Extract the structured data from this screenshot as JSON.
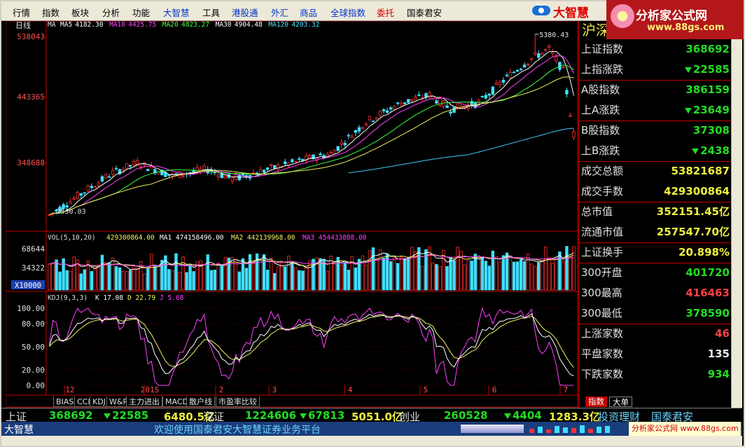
{
  "menu": {
    "items": [
      {
        "label": "行情",
        "style": "normal",
        "pos": 18
      },
      {
        "label": "指数",
        "style": "normal",
        "pos": 60
      },
      {
        "label": "板块",
        "style": "normal",
        "pos": 102
      },
      {
        "label": "分析",
        "style": "normal",
        "pos": 146
      },
      {
        "label": "功能",
        "style": "normal",
        "pos": 189
      },
      {
        "label": "大智慧",
        "style": "blue",
        "pos": 233
      },
      {
        "label": "工具",
        "style": "normal",
        "pos": 289
      },
      {
        "label": "港股通",
        "style": "blue",
        "pos": 331
      },
      {
        "label": "外汇",
        "style": "blue",
        "pos": 387
      },
      {
        "label": "商品",
        "style": "blue",
        "pos": 428
      },
      {
        "label": "全球指数",
        "style": "blue",
        "pos": 472
      },
      {
        "label": "委托",
        "style": "red",
        "pos": 538
      },
      {
        "label": "国泰君安",
        "style": "normal",
        "pos": 581
      }
    ],
    "brand": "大智慧"
  },
  "watermark": {
    "title": "分析家公式网",
    "url": "www.88gs.com"
  },
  "chart": {
    "period_label": "日线",
    "ma_line": {
      "prefix": "MA",
      "items": [
        {
          "name": "MA5",
          "value": "4182.30",
          "color": "#ffffff"
        },
        {
          "name": "MA10",
          "value": "4425.75",
          "color": "#ff40ff"
        },
        {
          "name": "MA20",
          "value": "4823.27",
          "color": "#40ff40"
        },
        {
          "name": "MA30",
          "value": "4904.48",
          "color": "#ffffff"
        },
        {
          "name": "MA120",
          "value": "4203.32",
          "color": "#40e0ff"
        }
      ]
    },
    "price_axis": [
      "538043",
      "443365",
      "348688"
    ],
    "high_label": "5380.43",
    "low_label": "2530.03",
    "vol_line": {
      "label": "VOL(5,10,20)",
      "vol": "429300864.00",
      "ma1": "MA1 474158496.00",
      "ma2": "MA2 442139968.00",
      "ma3": "MA3 454433888.00"
    },
    "vol_axis": [
      "68644",
      "34322"
    ],
    "vol_unit": "X10000",
    "kdj_line": {
      "label": "KDJ(9,3,3)",
      "k": "K 17.08",
      "d": "D 22.79",
      "j": "J 5.68"
    },
    "kdj_axis": [
      "100.00",
      "80.00",
      "50.00",
      "20.00",
      "0.00"
    ],
    "x_labels": [
      "12",
      "2015",
      "2",
      "3",
      "4",
      "5",
      "6",
      "7"
    ]
  },
  "chart_data": {
    "type": "candlestick",
    "title": "",
    "xlabel": "",
    "ylabel": "",
    "price_ylim": [
      2530.03,
      5380.43
    ],
    "annotations": {
      "high": "5380.43",
      "low": "2530.03"
    },
    "ma_latest": {
      "MA5": 4182.3,
      "MA10": 4425.75,
      "MA20": 4823.27,
      "MA30": 4904.48,
      "MA120": 4203.32
    },
    "volume_latest": {
      "VOL": 429300864.0,
      "MA1": 474158496.0,
      "MA2": 442139968.0,
      "MA3": 454433888.0
    },
    "kdj_latest": {
      "K": 17.08,
      "D": 22.79,
      "J": 5.68
    },
    "months": [
      "12",
      "2015",
      "2",
      "3",
      "4",
      "5",
      "6",
      "7"
    ]
  },
  "right_panel": {
    "title": "沪深",
    "rows": [
      {
        "label": "上证指数",
        "value": "368692",
        "cls": "down",
        "arrow": false
      },
      {
        "label": "上指涨跌",
        "value": "22585",
        "cls": "down",
        "arrow": true
      },
      {
        "label": "A股指数",
        "value": "386159",
        "cls": "down",
        "arrow": false
      },
      {
        "label": "上A涨跌",
        "value": "23649",
        "cls": "down",
        "arrow": true
      },
      {
        "label": "B股指数",
        "value": "37308",
        "cls": "down",
        "arrow": false
      },
      {
        "label": "上B涨跌",
        "value": "2438",
        "cls": "down",
        "arrow": true
      },
      {
        "label": "成交总额",
        "value": "53821687",
        "cls": "yellow",
        "arrow": false
      },
      {
        "label": "成交手数",
        "value": "429300864",
        "cls": "yellow",
        "arrow": false
      },
      {
        "label": "总市值",
        "value": "352151.45亿",
        "cls": "yellow",
        "arrow": false
      },
      {
        "label": "流通市值",
        "value": "257547.70亿",
        "cls": "yellow",
        "arrow": false
      },
      {
        "label": "上证换手",
        "value": "20.898%",
        "cls": "yellow",
        "arrow": false
      },
      {
        "label": " 300开盘",
        "value": "401720",
        "cls": "down",
        "arrow": false
      },
      {
        "label": " 300最高",
        "value": "416463",
        "cls": "red",
        "arrow": false
      },
      {
        "label": " 300最低",
        "value": "378590",
        "cls": "down",
        "arrow": false
      },
      {
        "label": "上涨家数",
        "value": "46",
        "cls": "red",
        "arrow": false
      },
      {
        "label": "平盘家数",
        "value": "135",
        "cls": "white",
        "arrow": false
      },
      {
        "label": "下跌家数",
        "value": "934",
        "cls": "down",
        "arrow": false
      }
    ],
    "tabs": {
      "index": "指数",
      "big": "大单"
    }
  },
  "indicator_tabs": [
    "BIAS",
    "CCI",
    "KDJ",
    "W&R",
    "主力进出",
    "MACD",
    "散户线",
    "市盈率比较"
  ],
  "status_bar": {
    "sh_label": "上证",
    "sh_value": "368692",
    "sh_change": "22585",
    "sh_amount": "6480.5亿",
    "sz_label": "深证",
    "sz_value": "1224606",
    "sz_change": "67813",
    "sz_amount": "5051.0亿",
    "cy_label": "创业",
    "cy_value": "260528",
    "cy_change": "4404",
    "cy_amount": "1283.3亿",
    "invest": "投资理财",
    "broker": "国泰君安"
  },
  "status_bar2": {
    "brand": "大智慧",
    "welcome": "欢迎使用国泰君安大智慧证券业务平台",
    "watermark": "分析家公式网  www.88gs.com"
  }
}
